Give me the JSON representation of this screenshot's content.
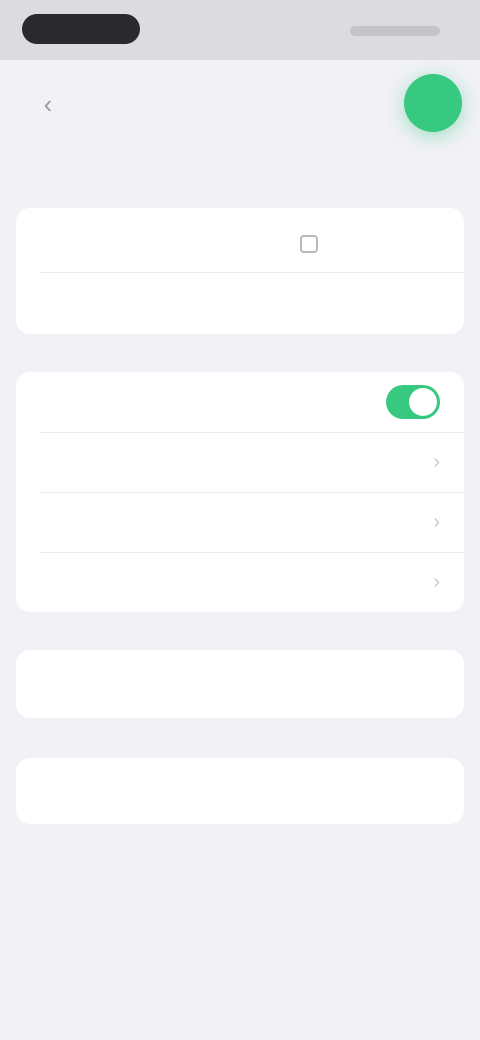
{
  "status_bar": {
    "time": "",
    "indicators": ""
  },
  "nav": {
    "back_icon": "chevron-left-icon",
    "action_icon": "plus-icon",
    "accent": "#37c980"
  },
  "title": "",
  "section1": {
    "rows": [
      {
        "label": "",
        "value": ""
      },
      {
        "label": "",
        "value": ""
      }
    ]
  },
  "section2": {
    "rows": [
      {
        "label": "",
        "toggle_on": true
      },
      {
        "label": ""
      },
      {
        "label": ""
      },
      {
        "label": ""
      }
    ]
  },
  "section3": {
    "placeholder": ""
  },
  "section4": {
    "action_label": ""
  }
}
